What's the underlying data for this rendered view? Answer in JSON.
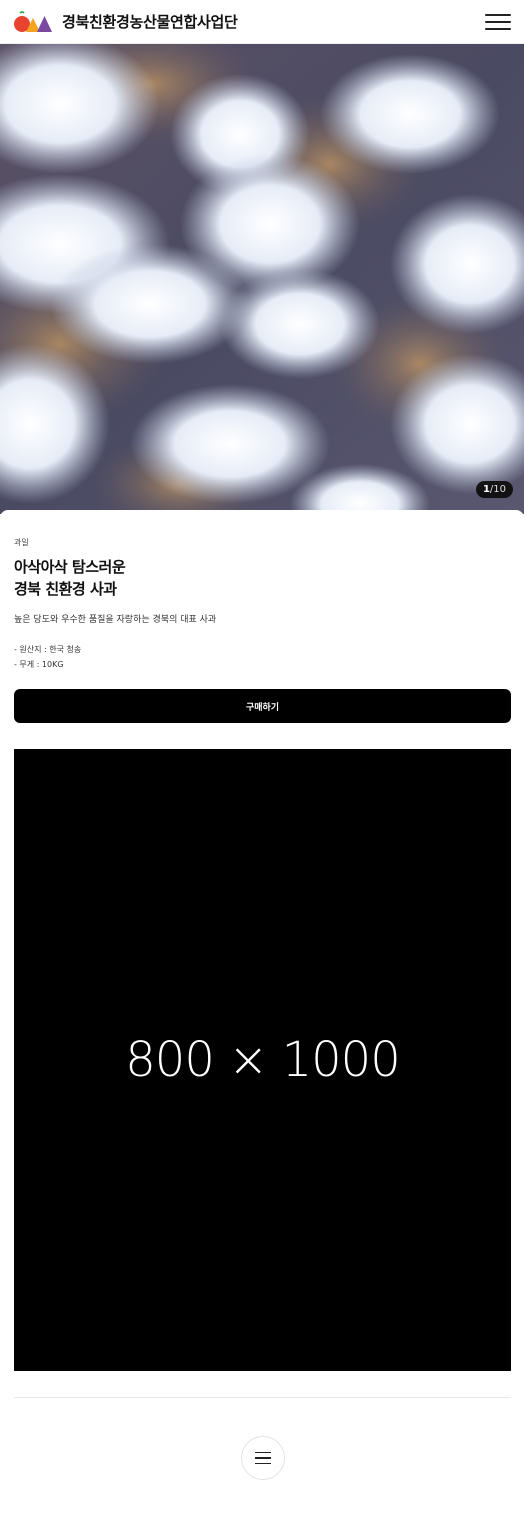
{
  "header": {
    "site_title": "경북친환경농산물연합사업단",
    "logo_icon": "logo-fruit-shapes-icon",
    "menu_icon": "hamburger-menu-icon"
  },
  "hero": {
    "slide_current": "1",
    "slide_total": "/10",
    "image_icon": "frost-aerial-photo"
  },
  "product": {
    "category": "과일",
    "title_line1": "아삭아삭 탐스러운",
    "title_line2": "경북 친환경 사과",
    "description": "높은 당도와 우수한 품질을 자랑하는 경북의 대표 사과",
    "spec_origin": "- 원산지 : 한국 청송",
    "spec_weight": "- 무게 : 10KG",
    "buy_label": "구매하기"
  },
  "detail_image": {
    "placeholder_text": "800 × 1000"
  },
  "footer": {
    "menu_icon": "menu-icon"
  },
  "colors": {
    "accent": "#000000",
    "logo_red": "#e8432e",
    "logo_orange": "#f3a51f",
    "logo_purple": "#7b4aa0",
    "logo_leaf": "#3aa64a"
  }
}
